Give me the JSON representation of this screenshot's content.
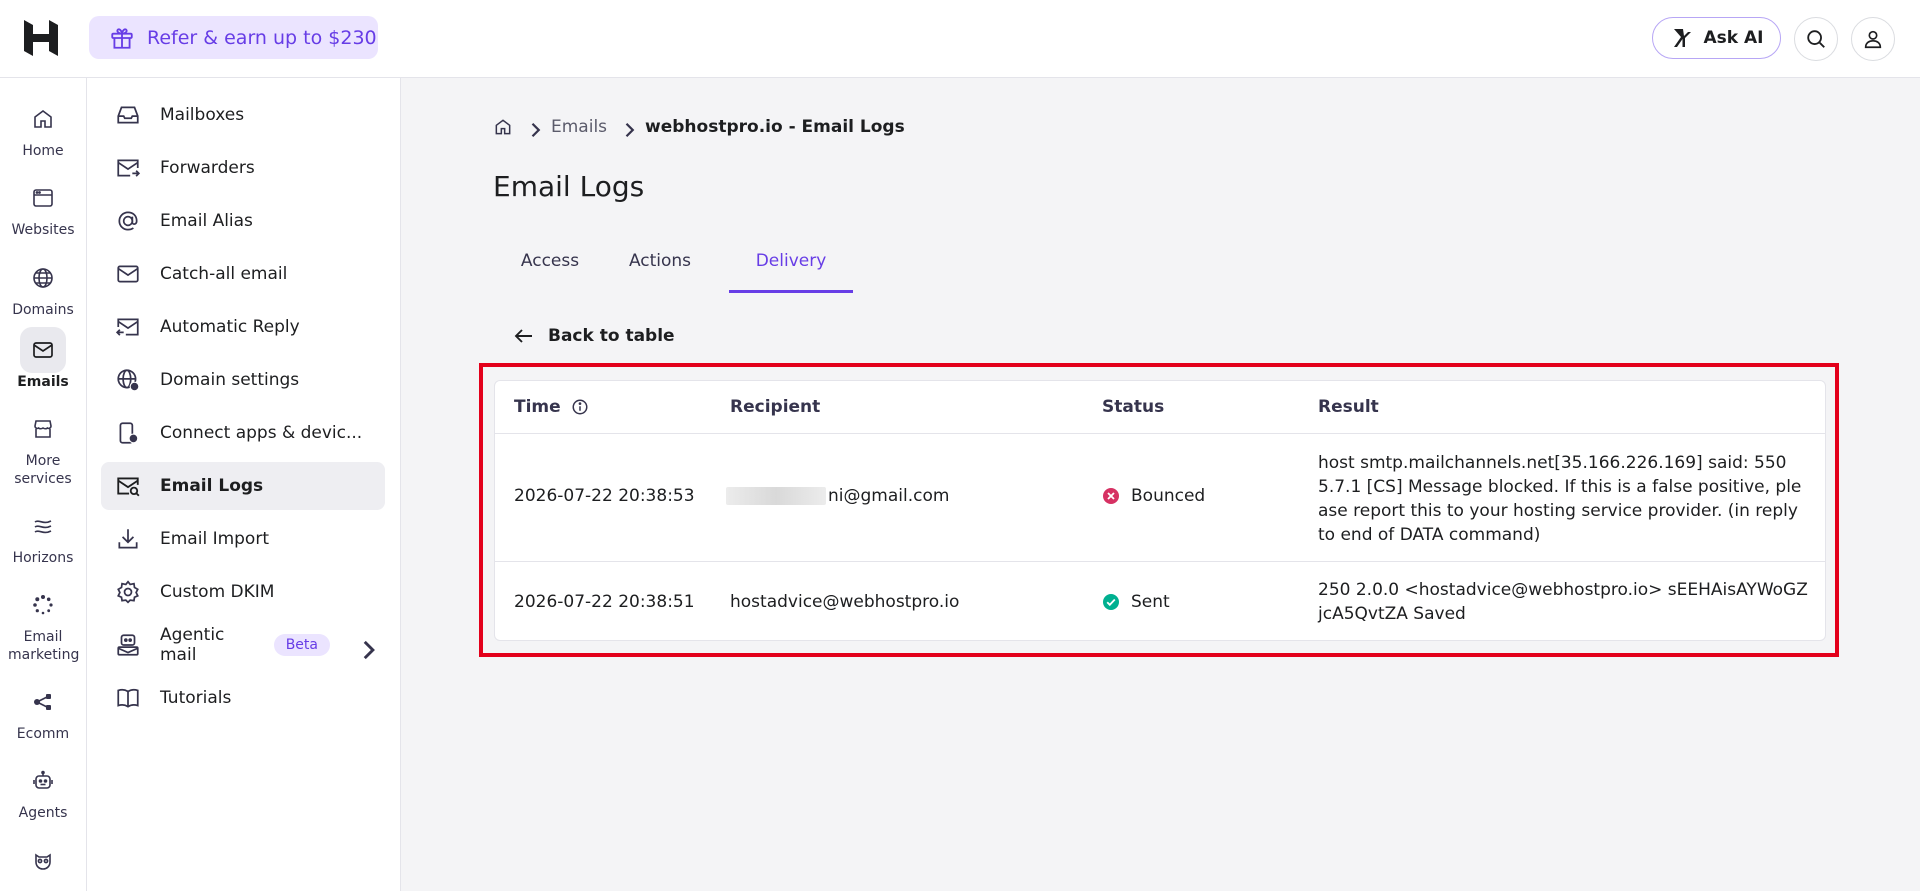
{
  "topbar": {
    "refer_label": "Refer & earn up to $230",
    "ask_ai_label": "Ask AI",
    "accent_color": "#673de6"
  },
  "rail": {
    "items": [
      {
        "label": "Home",
        "icon": "home-icon"
      },
      {
        "label": "Websites",
        "icon": "browser-icon"
      },
      {
        "label": "Domains",
        "icon": "globe-icon"
      },
      {
        "label": "Emails",
        "icon": "mail-icon",
        "active": true
      },
      {
        "label": "More services",
        "icon": "store-icon"
      },
      {
        "label": "Horizons",
        "icon": "horizons-icon"
      },
      {
        "label": "Email marketing",
        "icon": "spinner-icon"
      },
      {
        "label": "Ecomm",
        "icon": "share-nodes-icon"
      },
      {
        "label": "Agents",
        "icon": "robot-icon"
      },
      {
        "label": "",
        "icon": "owl-icon"
      }
    ]
  },
  "subnav": {
    "items": [
      {
        "label": "Mailboxes",
        "icon": "inbox-icon"
      },
      {
        "label": "Forwarders",
        "icon": "forward-mail-icon"
      },
      {
        "label": "Email Alias",
        "icon": "at-sign-icon"
      },
      {
        "label": "Catch-all email",
        "icon": "envelope-icon"
      },
      {
        "label": "Automatic Reply",
        "icon": "reply-mail-icon"
      },
      {
        "label": "Domain settings",
        "icon": "globe-gear-icon"
      },
      {
        "label": "Connect apps & devic...",
        "icon": "phone-link-icon"
      },
      {
        "label": "Email Logs",
        "icon": "mail-search-icon",
        "active": true
      },
      {
        "label": "Email Import",
        "icon": "download-icon"
      },
      {
        "label": "Custom DKIM",
        "icon": "gear-icon"
      },
      {
        "label": "Agentic mail",
        "icon": "agent-mail-icon",
        "badge": "Beta"
      },
      {
        "label": "Tutorials",
        "icon": "book-icon"
      }
    ]
  },
  "breadcrumb": {
    "home_icon": "home-icon",
    "parent": "Emails",
    "current": "webhostpro.io - Email Logs"
  },
  "page_title": "Email Logs",
  "tabs": [
    {
      "label": "Access"
    },
    {
      "label": "Actions"
    },
    {
      "label": "Delivery",
      "active": true
    }
  ],
  "back_label": "Back to table",
  "table": {
    "headers": {
      "time": "Time",
      "recipient": "Recipient",
      "status": "Status",
      "result": "Result"
    },
    "rows": [
      {
        "time": "2026-07-22 20:38:53",
        "recipient_visible": "ni@gmail.com",
        "recipient_redacted": true,
        "status": "Bounced",
        "status_color": "#d63163",
        "result": "host smtp.mailchannels.net[35.166.226.169] said: 550 5.7.1 [CS] Message blocked. If this is a false positive, please report this to your hosting service provider. (in reply to end of DATA command)"
      },
      {
        "time": "2026-07-22 20:38:51",
        "recipient_visible": "hostadvice@webhostpro.io",
        "recipient_redacted": false,
        "status": "Sent",
        "status_color": "#00b090",
        "result": "250 2.0.0 <hostadvice@webhostpro.io> sEEHAisAYWoGZjcA5QvtZA Saved"
      }
    ]
  }
}
